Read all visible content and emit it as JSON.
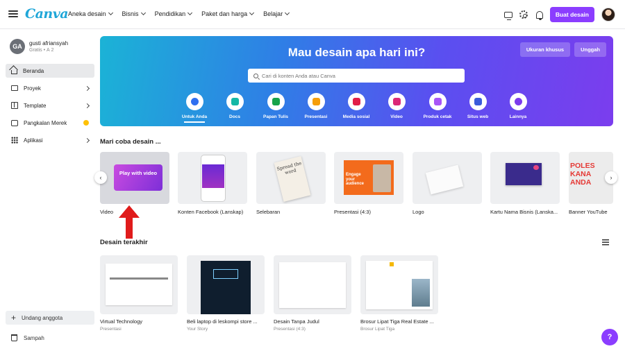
{
  "header": {
    "logo": "Canva",
    "menu": [
      {
        "label": "Aneka desain"
      },
      {
        "label": "Bisnis"
      },
      {
        "label": "Pendidikan"
      },
      {
        "label": "Paket dan harga"
      },
      {
        "label": "Belajar"
      }
    ],
    "create_button": "Buat desain"
  },
  "user": {
    "initials": "GA",
    "name": "gusti afriansyah",
    "plan": "Gratis • А 2"
  },
  "sidebar": {
    "items": [
      {
        "label": "Beranda"
      },
      {
        "label": "Proyek"
      },
      {
        "label": "Template"
      },
      {
        "label": "Pangkalan Merek"
      },
      {
        "label": "Aplikasi"
      }
    ],
    "invite": "Undang anggota",
    "trash": "Sampah"
  },
  "hero": {
    "title": "Mau desain apa hari ini?",
    "custom_size": "Ukuran khusus",
    "upload": "Unggah",
    "search_placeholder": "Cari di konten Anda atau Canva",
    "categories": [
      {
        "label": "Untuk Anda",
        "icon": "sparkle-icon",
        "color": "#2f6ff0"
      },
      {
        "label": "Docs",
        "icon": "doc-icon",
        "color": "#14b8a6"
      },
      {
        "label": "Papan Tulis",
        "icon": "whiteboard-icon",
        "color": "#16a34a"
      },
      {
        "label": "Presentasi",
        "icon": "presentation-icon",
        "color": "#f59e0b"
      },
      {
        "label": "Media sosial",
        "icon": "heart-icon",
        "color": "#e11d48"
      },
      {
        "label": "Video",
        "icon": "video-icon",
        "color": "#db2777"
      },
      {
        "label": "Produk cetak",
        "icon": "print-icon",
        "color": "#a855f7"
      },
      {
        "label": "Situs web",
        "icon": "website-icon",
        "color": "#3b5bdb"
      },
      {
        "label": "Lainnya",
        "icon": "more-icon",
        "color": "#7c3aed"
      }
    ]
  },
  "try_design": {
    "title": "Mari coba desain ...",
    "items": [
      {
        "label": "Video",
        "thumb_text": "Play with video"
      },
      {
        "label": "Konten Facebook (Lanskap)"
      },
      {
        "label": "Selebaran",
        "thumb_text": "Spread the word"
      },
      {
        "label": "Presentasi (4:3)",
        "thumb_text": "Engage your audience"
      },
      {
        "label": "Logo"
      },
      {
        "label": "Kartu Nama Bisnis (Lanska..."
      },
      {
        "label": "Banner YouTube",
        "thumb_text": "POLES KANA ANDA"
      }
    ]
  },
  "recent": {
    "title": "Desain terakhir",
    "items": [
      {
        "name": "Virtual Technology",
        "sub": "Presentasi"
      },
      {
        "name": "Beli laptop di leskompi store ...",
        "sub": "Your Story"
      },
      {
        "name": "Desain Tanpa Judul",
        "sub": "Presentasi (4:3)"
      },
      {
        "name": "Brosur Lipat Tiga Real Estate ...",
        "sub": "Brosur Lipat Tiga"
      }
    ]
  },
  "help": "?",
  "colors": {
    "brand": "#8b3dff",
    "annotation": "#e01b1b"
  }
}
